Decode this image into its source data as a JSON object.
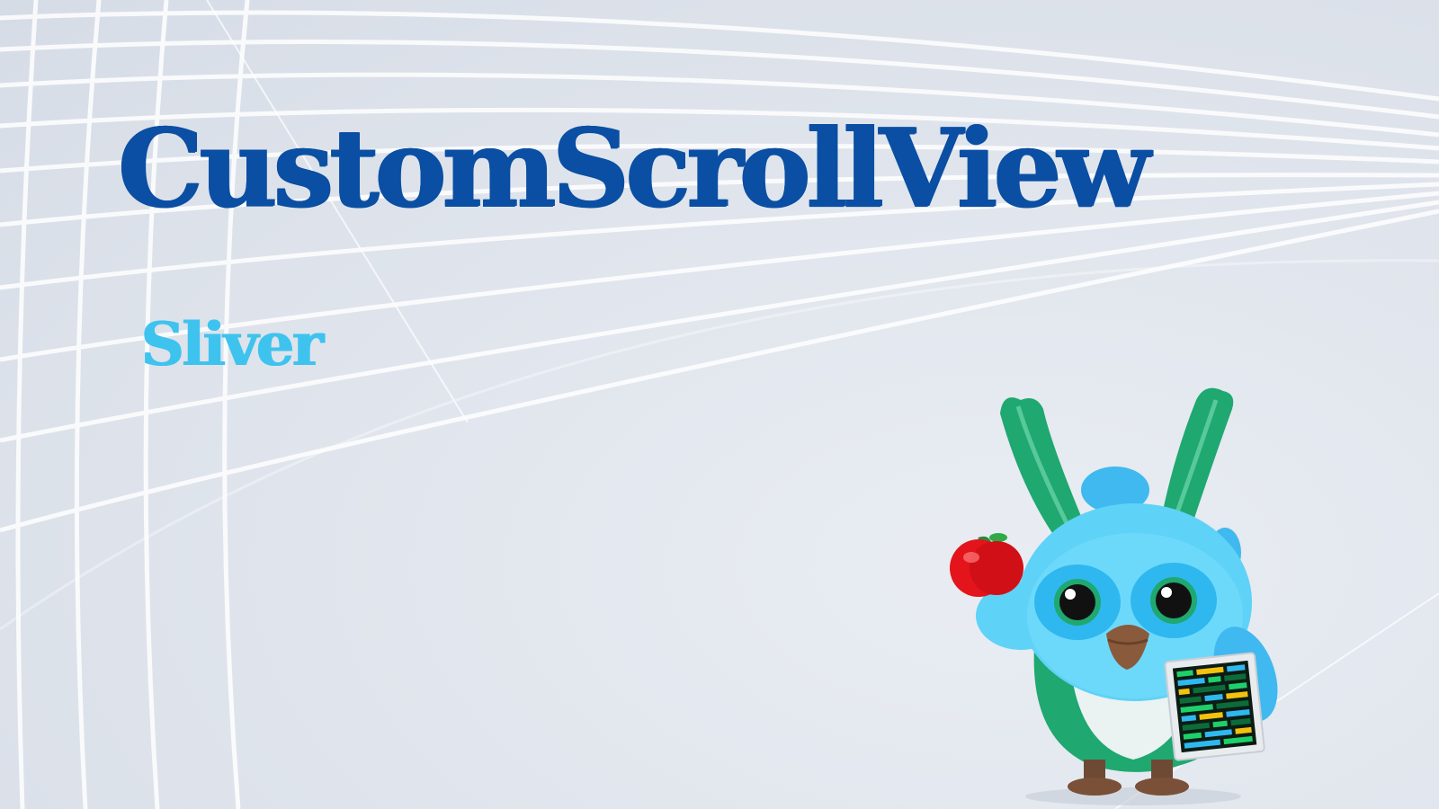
{
  "slide": {
    "title": "CustomScrollView",
    "subtitle": "Sliver"
  },
  "colors": {
    "title": "#0a4fa3",
    "subtitle": "#3ec3ef",
    "background": "#dfe4ec",
    "mascot_body": "#5fd2f7",
    "mascot_ears": "#1fa870",
    "apple": "#e3141b"
  },
  "decor": {
    "mascot": "bird-mascot-illustration",
    "apple_icon": "apple-icon",
    "tablet_icon": "tablet-icon"
  }
}
